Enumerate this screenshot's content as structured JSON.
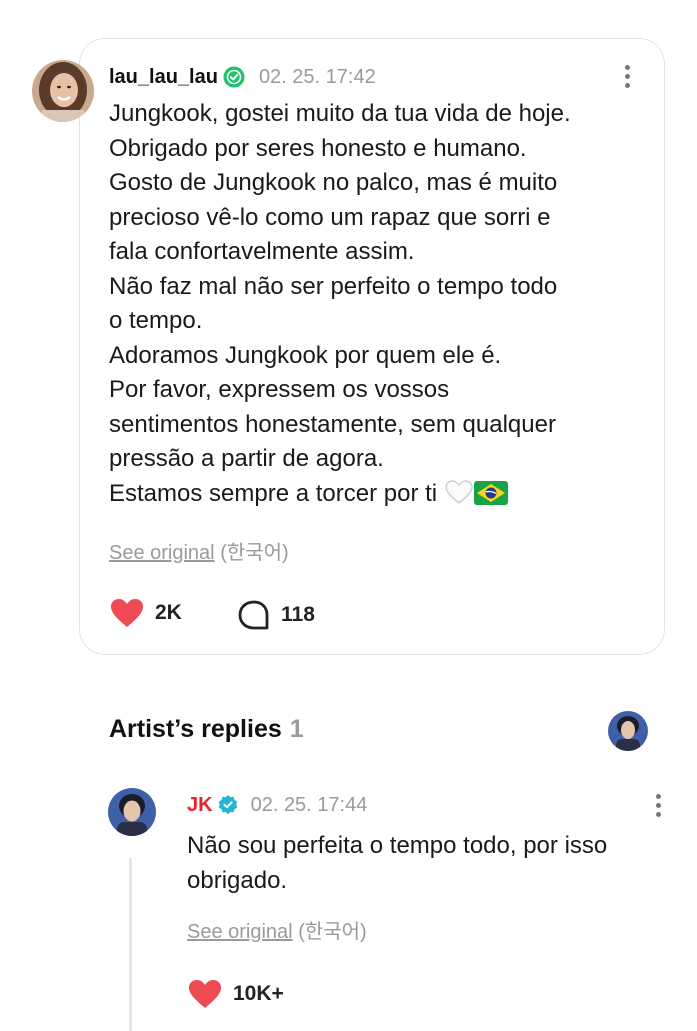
{
  "post": {
    "username": "lau_lau_lau",
    "timestamp": "02. 25. 17:42",
    "lines": [
      "Jungkook, gostei muito da tua vida de hoje.",
      "Obrigado por seres honesto e humano.",
      "Gosto de Jungkook no palco, mas é muito",
      "precioso vê-lo como um rapaz que sorri e",
      "fala confortavelmente assim.",
      "Não faz mal não ser perfeito o tempo todo",
      "o tempo.",
      "Adoramos Jungkook por quem ele é.",
      "Por favor, expressem os vossos",
      "sentimentos honestamente, sem qualquer",
      "pressão a partir de agora.",
      "Estamos sempre a torcer por ti"
    ],
    "see_original_link": "See original",
    "see_original_lang": "(한국어)",
    "likes": "2K",
    "comments": "118",
    "icons": {
      "verified": "verified-badge-icon",
      "like": "heart-icon",
      "comment": "comment-bubble-icon",
      "more": "more-vertical-icon",
      "emoji": [
        "white-heart-emoji",
        "brazil-flag-emoji"
      ]
    }
  },
  "artist_replies": {
    "title": "Artist’s replies",
    "count": "1"
  },
  "reply": {
    "name": "JK",
    "timestamp": "02. 25. 17:44",
    "lines": [
      "Não sou perfeita o tempo todo, por isso",
      "obrigado."
    ],
    "see_original_link": "See original",
    "see_original_lang": "(한국어)",
    "likes": "10K+"
  },
  "colors": {
    "like_red": "#ee4b55",
    "artist_name_red": "#e8232f",
    "verified_green": "#1fc16b",
    "verified_teal": "#23b5d3",
    "muted_gray": "#9a9a9a"
  }
}
